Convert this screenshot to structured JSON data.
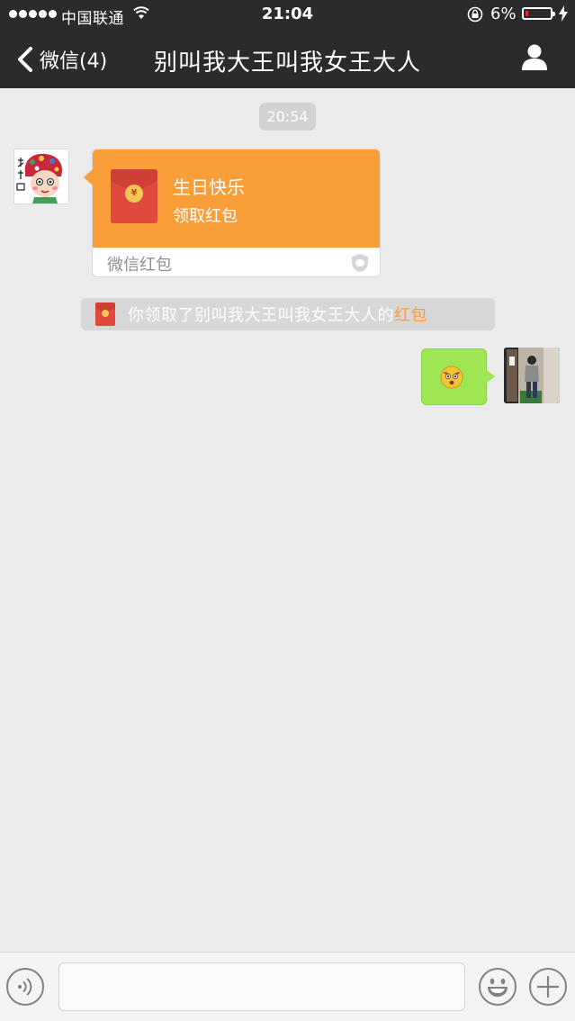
{
  "status_bar": {
    "carrier": "中国联通",
    "time": "21:04",
    "battery_percent": "6%",
    "battery_level": 0.06
  },
  "nav": {
    "back_label": "微信(4)",
    "title": "别叫我大王叫我女王大人"
  },
  "chat": {
    "timestamp": "20:54",
    "red_packet": {
      "greeting": "生日快乐",
      "action": "领取红包",
      "footer": "微信红包",
      "coin_symbol": "¥"
    },
    "system_note": {
      "prefix": "你领取了别叫我大王叫我女王大人的",
      "link": "红包"
    }
  },
  "colors": {
    "nav_bg": "#2b2b2d",
    "chat_bg": "#ebebeb",
    "red_packet_orange": "#fa9e3a",
    "bubble_green": "#9ee653",
    "envelope_red": "#e04a3d"
  },
  "icons": {
    "back": "chevron-left-icon",
    "profile": "person-icon",
    "voice": "voice-icon",
    "emoji": "smiley-icon",
    "plus": "plus-icon"
  }
}
